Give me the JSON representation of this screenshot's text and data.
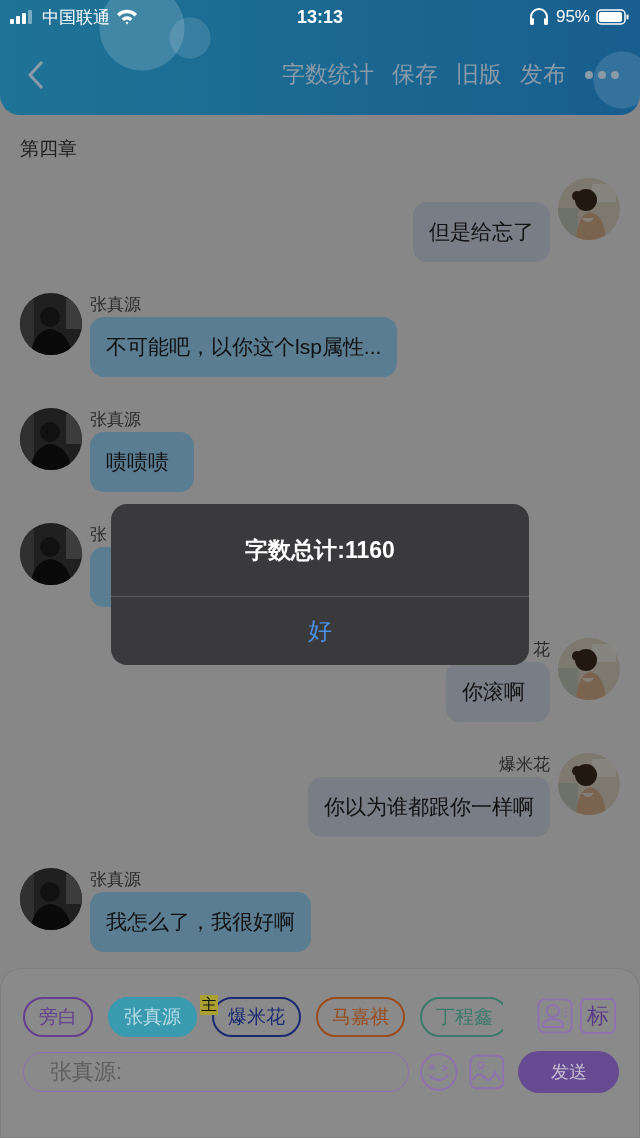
{
  "status_bar": {
    "carrier": "中国联通",
    "time": "13:13",
    "battery": "95%"
  },
  "header": {
    "actions": [
      "字数统计",
      "保存",
      "旧版",
      "发布"
    ]
  },
  "chapter": "第四章",
  "messages": [
    {
      "kind": "outgoing",
      "text": "但是给忘了"
    },
    {
      "kind": "incoming",
      "name": "张真源",
      "text": "不可能吧，以你这个lsp属性..."
    },
    {
      "kind": "incoming",
      "name": "张真源",
      "text": "啧啧啧"
    },
    {
      "kind": "incoming",
      "name": "张"
    },
    {
      "kind": "outgoing",
      "name": "花",
      "text": "你滚啊"
    },
    {
      "kind": "outgoing",
      "name": "爆米花",
      "text": "你以为谁都跟你一样啊"
    },
    {
      "kind": "incoming",
      "name": "张真源",
      "text": "我怎么了，我很好啊"
    }
  ],
  "dialog": {
    "title": "字数总计:1160",
    "button": "好"
  },
  "composer": {
    "roles": [
      {
        "label": "旁白",
        "color": "#643f8e",
        "selected": false
      },
      {
        "label": "张真源",
        "color": "#3a9ab0",
        "selected": true
      },
      {
        "label": "爆米花",
        "color": "#1a2a70",
        "selected": false,
        "badge": "主"
      },
      {
        "label": "马嘉祺",
        "color": "#9a4c1c",
        "selected": false
      },
      {
        "label": "丁程鑫",
        "color": "#3a7a6a",
        "selected": false
      }
    ],
    "mark_button": "标",
    "placeholder": "张真源:",
    "send": "发送"
  }
}
